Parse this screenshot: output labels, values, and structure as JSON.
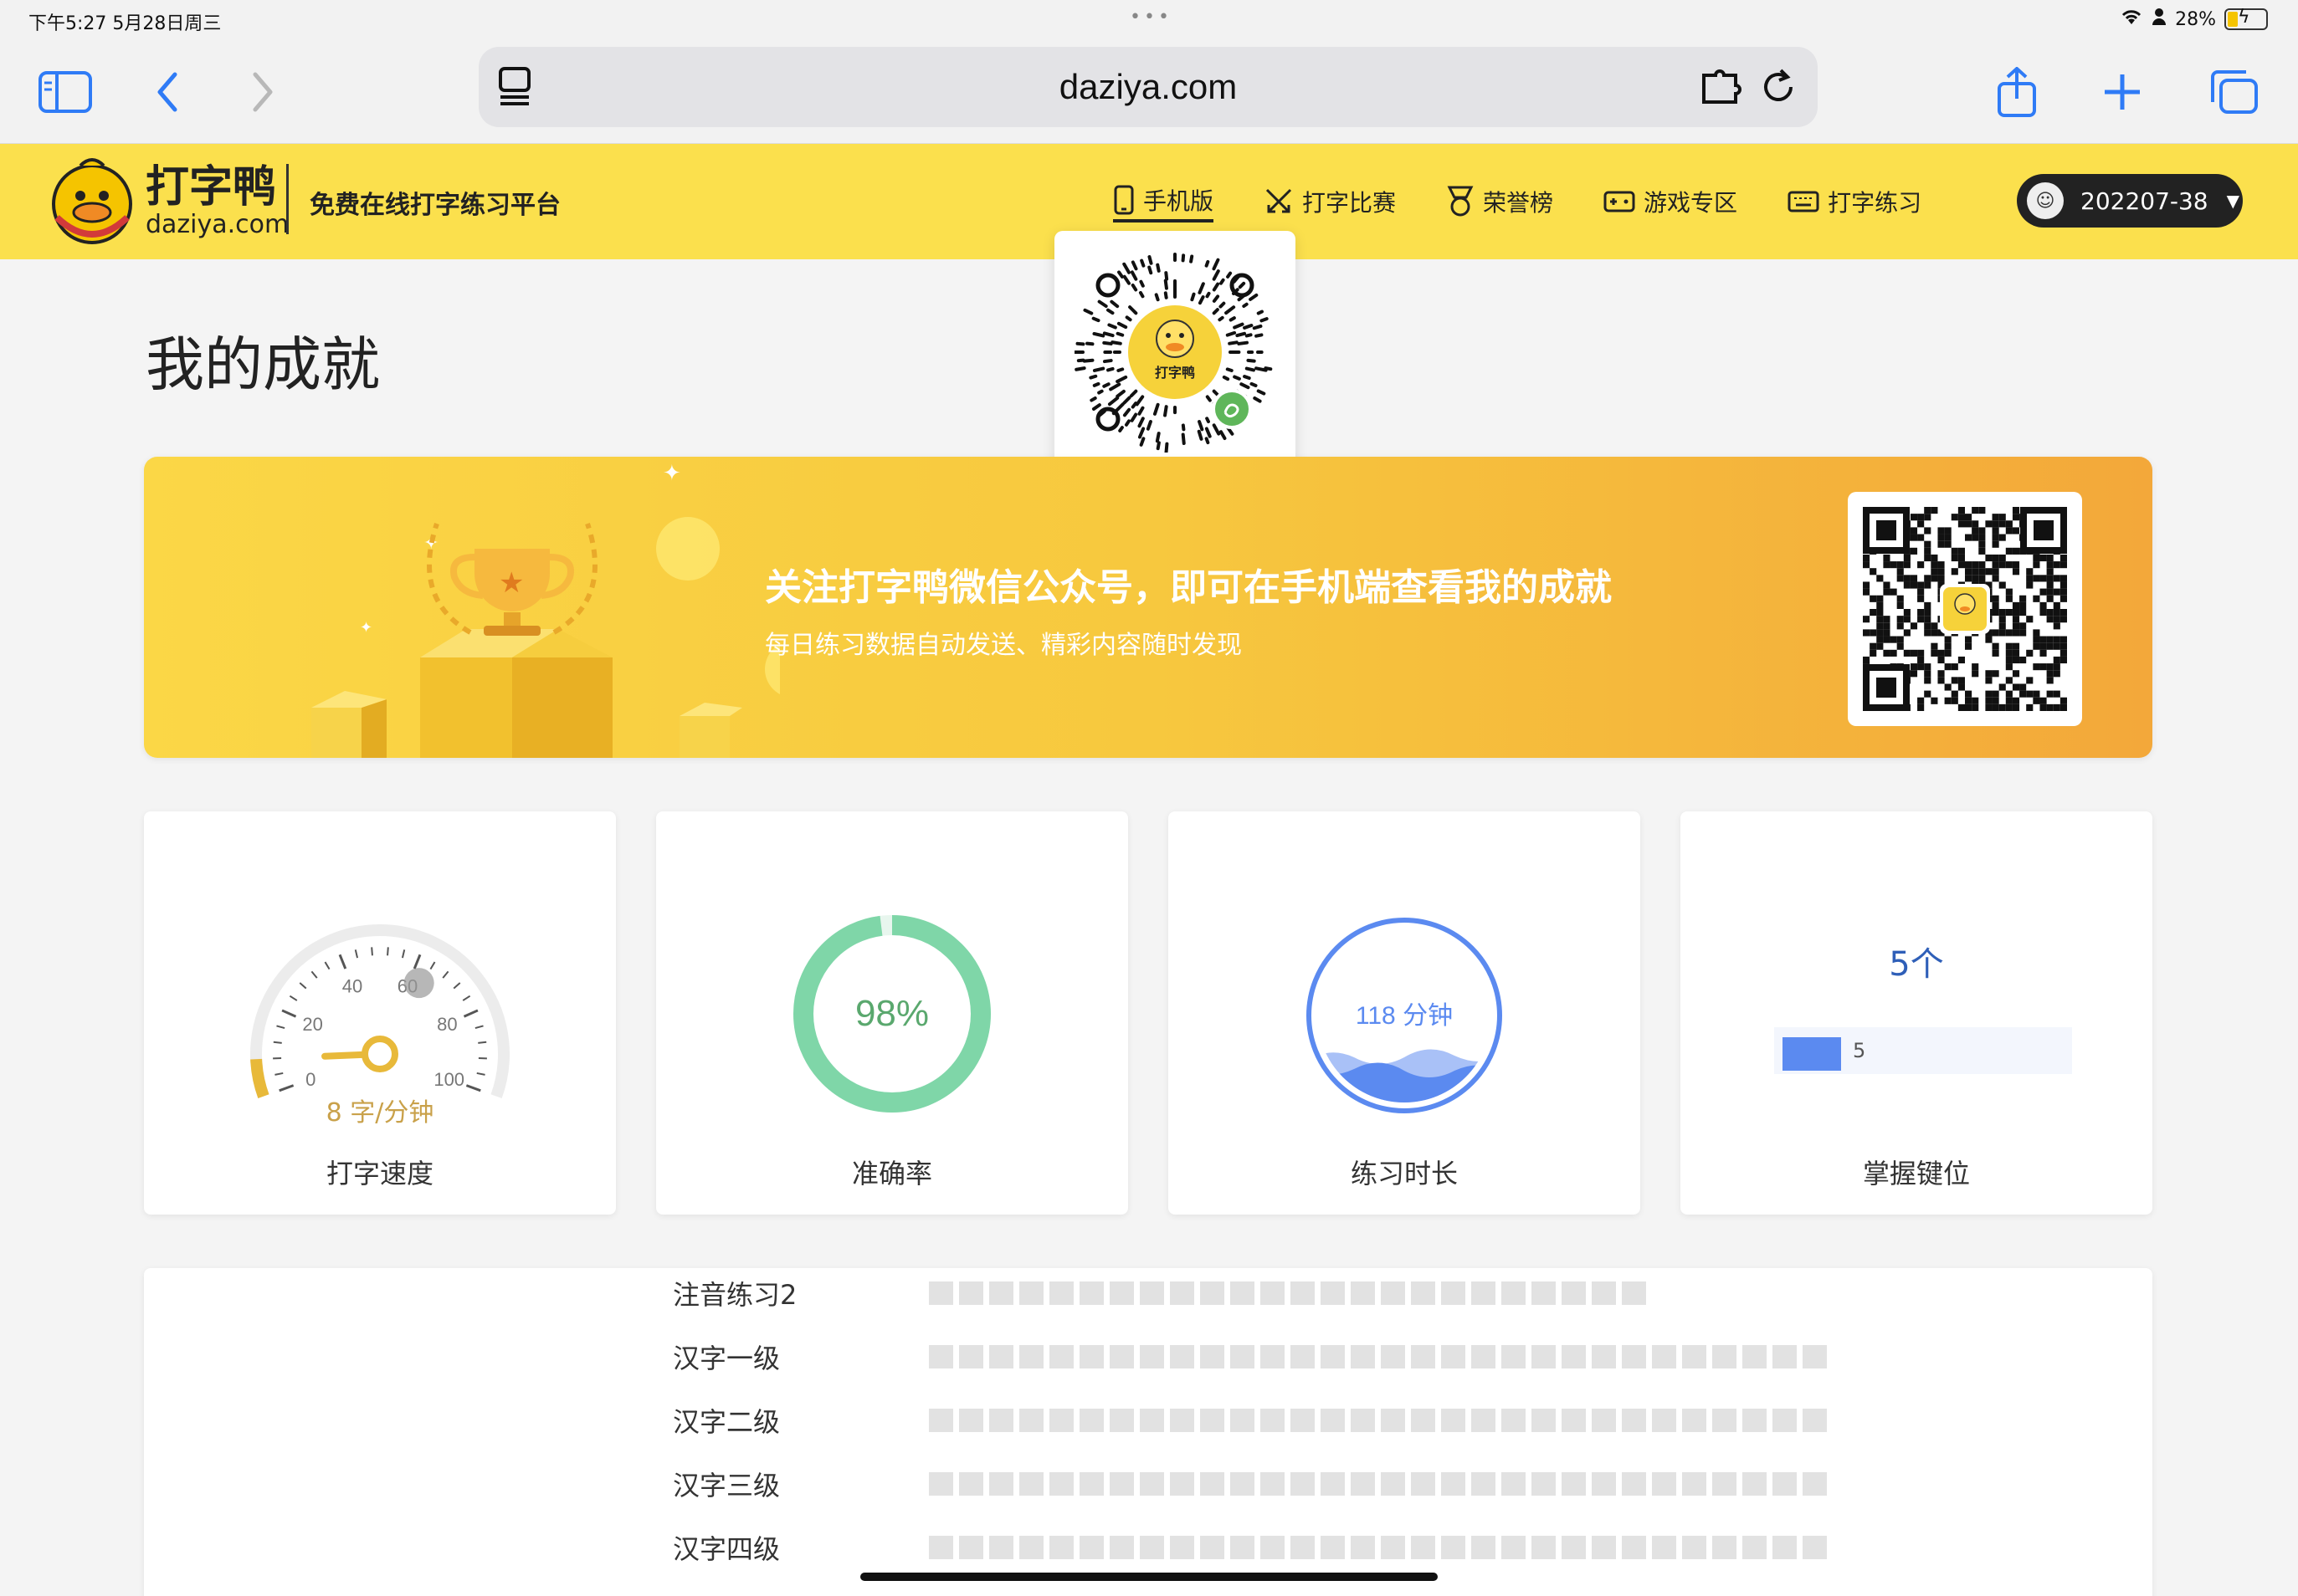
{
  "status_bar": {
    "time": "下午5:27  5月28日周三",
    "battery": "28%",
    "battery_level": 0.28
  },
  "browser": {
    "url": "daziya.com"
  },
  "site": {
    "brand_cn": "打字鸭",
    "brand_en": "daziya.com",
    "slogan": "免费在线打字练习平台",
    "nav": [
      {
        "label": "手机版",
        "icon": "phone-icon",
        "active": true
      },
      {
        "label": "打字比赛",
        "icon": "swords-icon"
      },
      {
        "label": "荣誉榜",
        "icon": "medal-icon"
      },
      {
        "label": "游戏专区",
        "icon": "gamepad-icon"
      },
      {
        "label": "打字练习",
        "icon": "keyboard-icon"
      }
    ],
    "user": {
      "name": "202207-38"
    }
  },
  "page": {
    "title": "我的成就"
  },
  "banner": {
    "headline": "关注打字鸭微信公众号，即可在手机端查看我的成就",
    "sub": "每日练习数据自动发送、精彩内容随时发现"
  },
  "qr_popup": {
    "caption": "打字鸭"
  },
  "stats": {
    "speed": {
      "label": "打字速度",
      "value_text": "8 字/分钟",
      "value": 8,
      "ticks": [
        "0",
        "20",
        "40",
        "60",
        "80",
        "100"
      ],
      "max": 100
    },
    "accuracy": {
      "label": "准确率",
      "value_text": "98%",
      "value": 98
    },
    "duration": {
      "label": "练习时长",
      "value_text": "118 分钟",
      "value": 118
    },
    "keys": {
      "label": "掌握键位",
      "value_text": "5个",
      "bar_value": "5",
      "value": 5
    }
  },
  "practice_list": [
    {
      "name": "注音练习2",
      "blocks": 24
    },
    {
      "name": "汉字一级",
      "blocks": 30
    },
    {
      "name": "汉字二级",
      "blocks": 30
    },
    {
      "name": "汉字三级",
      "blocks": 30
    },
    {
      "name": "汉字四级",
      "blocks": 30
    }
  ],
  "colors": {
    "brand_yellow": "#fbe04d",
    "accent_green": "#7fd6a8",
    "accent_blue": "#5b8af0",
    "gauge_gold": "#e8b93a"
  }
}
